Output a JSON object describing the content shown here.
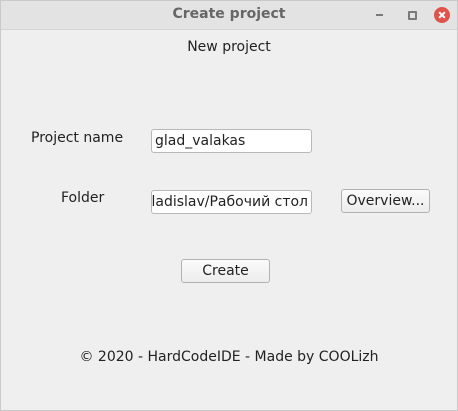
{
  "window": {
    "title": "Create project"
  },
  "dialog": {
    "heading": "New project",
    "project_name_label": "Project name",
    "project_name_value": "glad_valakas",
    "folder_label": "Folder",
    "folder_value": "/home/vladislav/Рабочий стол",
    "overview_button": "Overview...",
    "create_button": "Create",
    "footer": "© 2020 - HardCodeIDE - Made by COOLizh"
  },
  "icons": {
    "minimize": "minimize-icon",
    "maximize": "maximize-icon",
    "close": "close-icon"
  },
  "colors": {
    "close_button": "#e0534a",
    "background": "#efefef"
  }
}
